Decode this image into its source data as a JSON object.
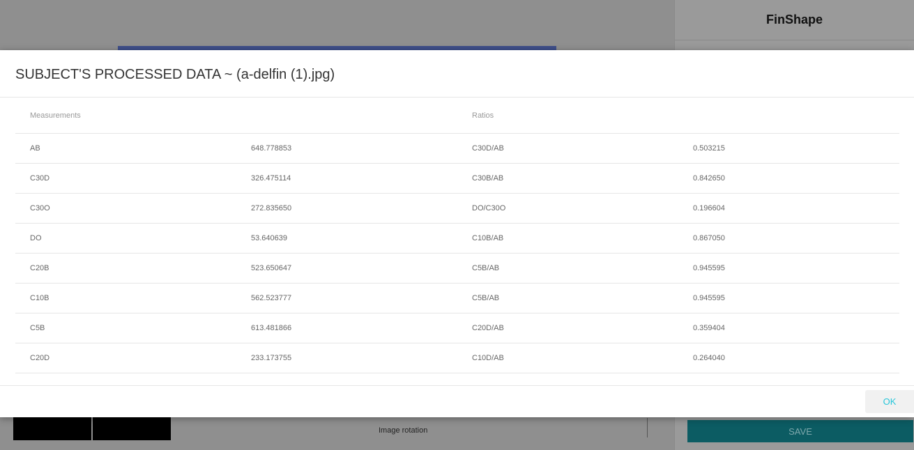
{
  "app": {
    "title": "FinShape",
    "rotation_label": "Image rotation",
    "save_label": "SAVE"
  },
  "modal": {
    "title": "SUBJECT'S PROCESSED DATA ~ (a-delfin (1).jpg)",
    "headers": {
      "measurements": "Measurements",
      "ratios": "Ratios"
    },
    "rows": [
      {
        "m_name": "AB",
        "m_value": "648.778853",
        "r_name": "C30D/AB",
        "r_value": "0.503215"
      },
      {
        "m_name": "C30D",
        "m_value": "326.475114",
        "r_name": "C30B/AB",
        "r_value": "0.842650"
      },
      {
        "m_name": "C30O",
        "m_value": "272.835650",
        "r_name": "DO/C30O",
        "r_value": "0.196604"
      },
      {
        "m_name": "DO",
        "m_value": "53.640639",
        "r_name": "C10B/AB",
        "r_value": "0.867050"
      },
      {
        "m_name": "C20B",
        "m_value": "523.650647",
        "r_name": "C5B/AB",
        "r_value": "0.945595"
      },
      {
        "m_name": "C10B",
        "m_value": "562.523777",
        "r_name": "C5B/AB",
        "r_value": "0.945595"
      },
      {
        "m_name": "C5B",
        "m_value": "613.481866",
        "r_name": "C20D/AB",
        "r_value": "0.359404"
      },
      {
        "m_name": "C20D",
        "m_value": "233.173755",
        "r_name": "C10D/AB",
        "r_value": "0.264040"
      }
    ],
    "ok_label": "OK"
  }
}
